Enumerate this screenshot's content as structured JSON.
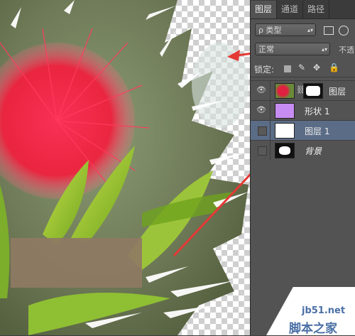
{
  "panel": {
    "tabs": [
      "图层",
      "通道",
      "路径"
    ],
    "filter": {
      "label": "ρ 类型",
      "arrow": "▴▾"
    },
    "blend": {
      "value": "正常",
      "opacity_label": "不透"
    },
    "lock_label": "锁定:",
    "layers": [
      {
        "name": "图层",
        "visible": true,
        "selected": false
      },
      {
        "name": "形状 1",
        "visible": true,
        "selected": false
      },
      {
        "name": "图层 1",
        "visible": false,
        "selected": true
      },
      {
        "name": "背景",
        "visible": false,
        "selected": false
      }
    ]
  },
  "watermark": {
    "site": "jb51.net",
    "brand": "脚本之家"
  },
  "colors": {
    "arrow": "#e53935",
    "selection": "#5b6c86",
    "panel_bg": "#535353"
  }
}
